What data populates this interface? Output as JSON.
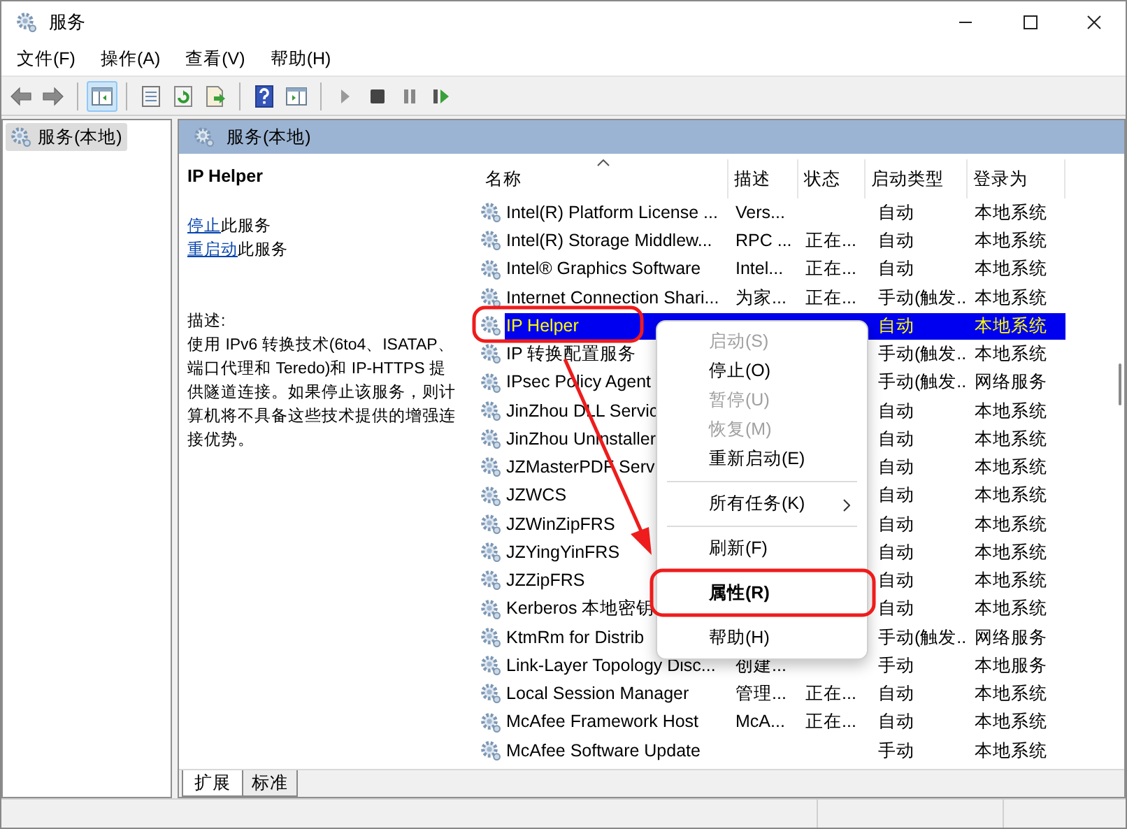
{
  "window": {
    "title": "服务"
  },
  "menu": [
    "文件(F)",
    "操作(A)",
    "查看(V)",
    "帮助(H)"
  ],
  "toolbar": [
    {
      "kind": "back",
      "selected": false
    },
    {
      "kind": "forward",
      "selected": false
    },
    {
      "kind": "separator"
    },
    {
      "kind": "tree",
      "selected": true
    },
    {
      "kind": "separator"
    },
    {
      "kind": "properties",
      "selected": false
    },
    {
      "kind": "refresh",
      "selected": false
    },
    {
      "kind": "export",
      "selected": false
    },
    {
      "kind": "separator"
    },
    {
      "kind": "help",
      "selected": false
    },
    {
      "kind": "view",
      "selected": false
    },
    {
      "kind": "separator"
    },
    {
      "kind": "play",
      "selected": false
    },
    {
      "kind": "stop",
      "selected": false
    },
    {
      "kind": "pause",
      "selected": false
    },
    {
      "kind": "resume",
      "selected": false
    }
  ],
  "tree": [
    {
      "label": "服务(本地)",
      "selected": true
    }
  ],
  "panel": {
    "title": "服务(本地)"
  },
  "details": {
    "service_name": "IP Helper",
    "actions": [
      {
        "link": "停止",
        "text": "此服务"
      },
      {
        "link": "重启动",
        "text": "此服务"
      }
    ],
    "description_label": "描述:",
    "description": "使用 IPv6 转换技术(6to4、ISATAP、端口代理和 Teredo)和 IP-HTTPS 提供隧道连接。如果停止该服务，则计算机将不具备这些技术提供的增强连接优势。"
  },
  "list": {
    "columns": [
      {
        "label": "名称",
        "sorted": true
      },
      {
        "label": "描述",
        "sorted": false
      },
      {
        "label": "状态",
        "sorted": false
      },
      {
        "label": "启动类型",
        "sorted": false
      },
      {
        "label": "登录为",
        "sorted": false
      }
    ],
    "rows": [
      {
        "name": "Intel(R) Platform License ...",
        "description": "Vers...",
        "startup": "自动",
        "logon": "本地系统",
        "selected": false
      },
      {
        "name": "Intel(R) Storage Middlew...",
        "description": "RPC ...",
        "status": "正在...",
        "startup": "自动",
        "logon": "本地系统",
        "selected": false
      },
      {
        "name": "Intel® Graphics Software",
        "description": "Intel...",
        "status": "正在...",
        "startup": "自动",
        "logon": "本地系统",
        "selected": false
      },
      {
        "name": "Internet Connection Shari...",
        "description": "为家...",
        "status": "正在...",
        "startup": "手动(触发...",
        "logon": "本地系统",
        "selected": false
      },
      {
        "name": "IP Helper",
        "startup": "自动",
        "logon": "本地系统",
        "selected": true
      },
      {
        "name": "IP 转换配置服务",
        "startup": "手动(触发...",
        "logon": "本地系统",
        "selected": false
      },
      {
        "name": "IPsec Policy Agent",
        "startup": "手动(触发...",
        "logon": "网络服务",
        "selected": false
      },
      {
        "name": "JinZhou DLL Servic",
        "startup": "自动",
        "logon": "本地系统",
        "selected": false
      },
      {
        "name": "JinZhou Uninstaller",
        "startup": "自动",
        "logon": "本地系统",
        "selected": false
      },
      {
        "name": "JZMasterPDF Serv",
        "startup": "自动",
        "logon": "本地系统",
        "selected": false
      },
      {
        "name": "JZWCS",
        "startup": "自动",
        "logon": "本地系统",
        "selected": false
      },
      {
        "name": "JZWinZipFRS",
        "startup": "自动",
        "logon": "本地系统",
        "selected": false
      },
      {
        "name": "JZYingYinFRS",
        "startup": "自动",
        "logon": "本地系统",
        "selected": false
      },
      {
        "name": "JZZipFRS",
        "startup": "自动",
        "logon": "本地系统",
        "selected": false
      },
      {
        "name": "Kerberos 本地密钥",
        "startup": "自动",
        "logon": "本地系统",
        "selected": false
      },
      {
        "name": "KtmRm for Distrib",
        "startup": "手动(触发...",
        "logon": "网络服务",
        "selected": false
      },
      {
        "name": "Link-Layer Topology Disc...",
        "description": "创建...",
        "startup": "手动",
        "logon": "本地服务",
        "selected": false
      },
      {
        "name": "Local Session Manager",
        "description": "管理...",
        "status": "正在...",
        "startup": "自动",
        "logon": "本地系统",
        "selected": false
      },
      {
        "name": "McAfee Framework Host",
        "description": "McA...",
        "status": "正在...",
        "startup": "自动",
        "logon": "本地系统",
        "selected": false
      },
      {
        "name": "McAfee Software Update",
        "startup": "手动",
        "logon": "本地系统",
        "selected": false
      }
    ]
  },
  "context_menu": {
    "items": [
      {
        "kind": "item",
        "label": "启动(S)",
        "disabled": true
      },
      {
        "kind": "item",
        "label": "停止(O)",
        "disabled": false
      },
      {
        "kind": "item",
        "label": "暂停(U)",
        "disabled": true
      },
      {
        "kind": "item",
        "label": "恢复(M)",
        "disabled": true
      },
      {
        "kind": "item",
        "label": "重新启动(E)",
        "disabled": false
      },
      {
        "kind": "separator"
      },
      {
        "kind": "submenu",
        "label": "所有任务(K)",
        "disabled": false
      },
      {
        "kind": "separator"
      },
      {
        "kind": "item",
        "label": "刷新(F)",
        "disabled": false
      },
      {
        "kind": "separator"
      },
      {
        "kind": "default",
        "label": "属性(R)",
        "disabled": false
      },
      {
        "kind": "separator"
      },
      {
        "kind": "item",
        "label": "帮助(H)",
        "disabled": false
      }
    ]
  },
  "tabs": [
    {
      "label": "扩展",
      "selected": true
    },
    {
      "label": "标准",
      "selected": false
    }
  ]
}
